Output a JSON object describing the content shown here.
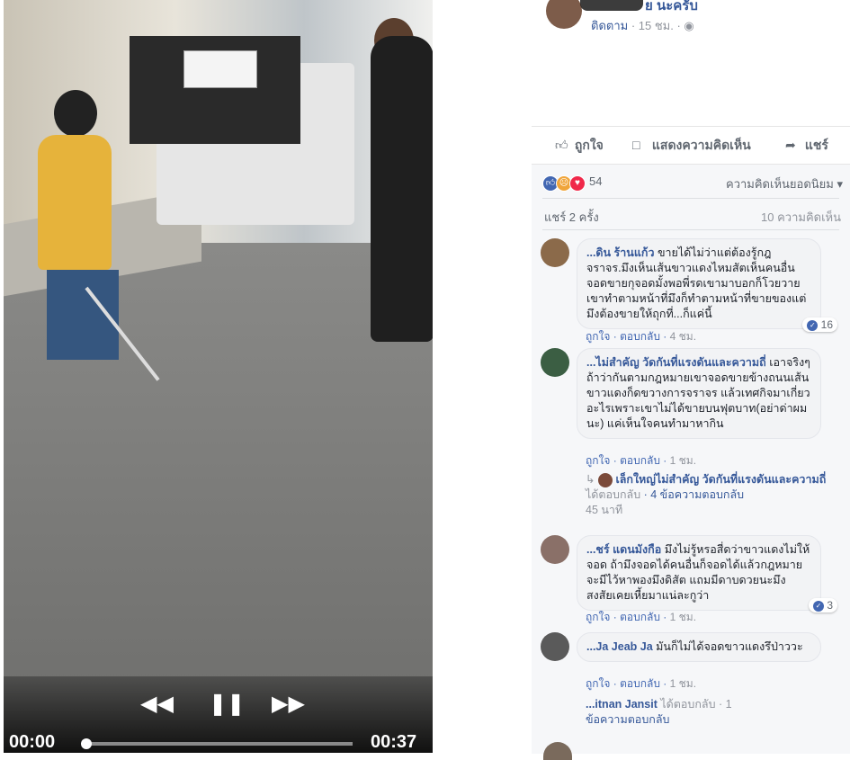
{
  "video": {
    "controls": {
      "rewind_icon": "rewind-icon",
      "pause_icon": "pause-icon",
      "forward_icon": "fast-forward-icon"
    },
    "time_current": "00:00",
    "time_total": "00:37",
    "progress_fraction": 0.0
  },
  "post": {
    "author_partial": "ย นะครับ",
    "follow_label": "ติดตาม",
    "time": "15 ชม.",
    "privacy_icon": "globe-icon"
  },
  "actions": {
    "like": "ถูกใจ",
    "comment": "แสดงความคิดเห็น",
    "share": "แชร์"
  },
  "summary": {
    "reaction_count": "54",
    "sort_label": "ความคิดเห็นยอดนิยม",
    "shares": "แชร์ 2 ครั้ง",
    "comments": "10 ความคิดเห็น"
  },
  "comments": [
    {
      "name": "...ดิน ร้านแก้ว",
      "text": "ขายได้ไม่ว่าแต่ต้องรู้กฎจราจร.มึงเห็นเส้นขาวแดงไหมสัตเห็นคนอื่นจอดขายกุจอดมั้งพอพี่รดเขามาบอกก็โวยวายเขาทำตามหน้าที่มึงก็ทำตามหน้าที่ขายของแต่มึงต้องขายให้ถุกที่...ก็แค่นี้",
      "like": "ถูกใจ",
      "reply": "ตอบกลับ",
      "time": "4 ชม.",
      "likes": "16"
    },
    {
      "name": "...ไม่สำคัญ วัดกันที่แรงดันและความถี่",
      "text": "เอาจริงๆถ้าว่ากันตามกฎหมายเขาจอดขายข้างถนนเส้นขาวแดงก็ดขวางการจราจร แล้วเทศกิจมาเกี่ยวอะไรเพราะเขาไม่ได้ขายบนฟุตบาท(อย่าด่าผมนะ) แค่เห็นใจคนทำมาหากิน",
      "like": "ถูกใจ",
      "reply": "ตอบกลับ",
      "time": "1 ชม.",
      "reply_summary": {
        "name": "เล็กใหญ่ไม่สำคัญ วัดกันที่แรงดันและความถี่",
        "action": "ได้ตอบกลับ",
        "count": "4 ข้อความตอบกลับ",
        "time": "45 นาที"
      }
    },
    {
      "name": "...ชร์ แดนมังกือ",
      "text": "มึงไม่รู้หรอสี่ดว่าขาวแดงไม่ให้จอด ถ้ามึงจอดได้คนอื่นก็จอดได้แล้วกฎหมายจะมีไว้หาพองมึงดิสัต แถมมีดาบดวยนะมึง สงสัยเคยเหี้ยมาแน่ละกูว่า",
      "like": "ถูกใจ",
      "reply": "ตอบกลับ",
      "time": "1 ชม.",
      "likes": "3"
    },
    {
      "name": "...Ja Jeab Ja",
      "text": "มันก็ไม่ได้จอดขาวแดงรึป่าววะ",
      "like": "ถูกใจ",
      "reply": "ตอบกลับ",
      "time": "1 ชม.",
      "reply_summary": {
        "name": "...itnan Jansit",
        "action": "ได้ตอบกลับ · 1",
        "count": "ข้อความตอบกลับ"
      }
    }
  ]
}
